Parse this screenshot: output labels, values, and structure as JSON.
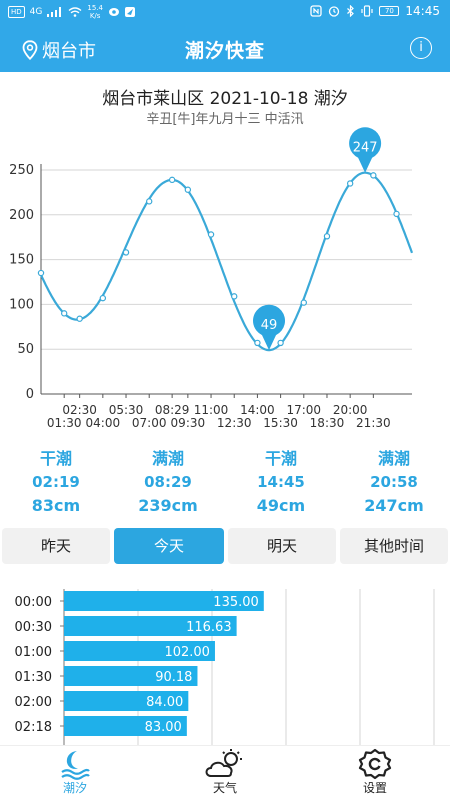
{
  "status": {
    "network": "HD",
    "signal": "4G",
    "speed_value": "15.4",
    "speed_unit": "K/s",
    "time": "14:45",
    "battery": "70"
  },
  "header": {
    "location": "烟台市",
    "title": "潮汐快查",
    "info": "i"
  },
  "page_title": "烟台市莱山区 2021-10-18 潮汐",
  "lunar": "辛丑[牛]年九月十三 中活汛",
  "chart_data": {
    "type": "line",
    "ylim": [
      0,
      250
    ],
    "yticks": [
      0,
      50,
      100,
      150,
      200,
      250
    ],
    "xlim": [
      0,
      24
    ],
    "xtick_labels_top": [
      "02:30",
      "05:30",
      "08:29",
      "11:00",
      "14:00",
      "17:00",
      "20:00"
    ],
    "xtick_values_top": [
      2.5,
      5.5,
      8.483,
      11,
      14,
      17,
      20
    ],
    "xtick_labels_bottom": [
      "01:30",
      "04:00",
      "07:00",
      "09:30",
      "12:30",
      "15:30",
      "18:30",
      "21:30"
    ],
    "xtick_values_bottom": [
      1.5,
      4,
      7,
      9.5,
      12.5,
      15.5,
      18.5,
      21.5
    ],
    "x": [
      0,
      1.5,
      2.5,
      4,
      5.5,
      7,
      8.483,
      9.5,
      11,
      12.5,
      14,
      15.5,
      17,
      18.5,
      20,
      21.5,
      23
    ],
    "y": [
      135,
      90,
      84,
      107,
      158,
      215,
      239,
      228,
      178,
      109,
      57,
      57,
      102,
      176,
      235,
      244,
      201
    ],
    "callouts": [
      {
        "x": 14.75,
        "y": 49,
        "label": "49"
      },
      {
        "x": 20.967,
        "y": 247,
        "label": "247"
      }
    ],
    "line_color": "#3aa9d8"
  },
  "tides": [
    {
      "type": "干潮",
      "time": "02:19",
      "height": "83cm"
    },
    {
      "type": "满潮",
      "time": "08:29",
      "height": "239cm"
    },
    {
      "type": "干潮",
      "time": "14:45",
      "height": "49cm"
    },
    {
      "type": "满潮",
      "time": "20:58",
      "height": "247cm"
    }
  ],
  "tabs": [
    {
      "label": "昨天",
      "active": false
    },
    {
      "label": "今天",
      "active": true
    },
    {
      "label": "明天",
      "active": false
    },
    {
      "label": "其他时间",
      "active": false
    }
  ],
  "table": {
    "max": 250,
    "rows": [
      {
        "time": "00:00",
        "value": 135.0,
        "label": "135.00"
      },
      {
        "time": "00:30",
        "value": 116.63,
        "label": "116.63"
      },
      {
        "time": "01:00",
        "value": 102.0,
        "label": "102.00"
      },
      {
        "time": "01:30",
        "value": 90.18,
        "label": "90.18"
      },
      {
        "time": "02:00",
        "value": 84.0,
        "label": "84.00"
      },
      {
        "time": "02:18",
        "value": 83.0,
        "label": "83.00"
      }
    ]
  },
  "nav": [
    {
      "label": "潮汐",
      "icon": "moon-wave-icon",
      "active": true
    },
    {
      "label": "天气",
      "icon": "weather-icon",
      "active": false
    },
    {
      "label": "设置",
      "icon": "settings-icon",
      "active": false
    }
  ],
  "colors": {
    "brand": "#31a8e8",
    "accent": "#2ca6e0",
    "bar": "#1fb0ea"
  }
}
